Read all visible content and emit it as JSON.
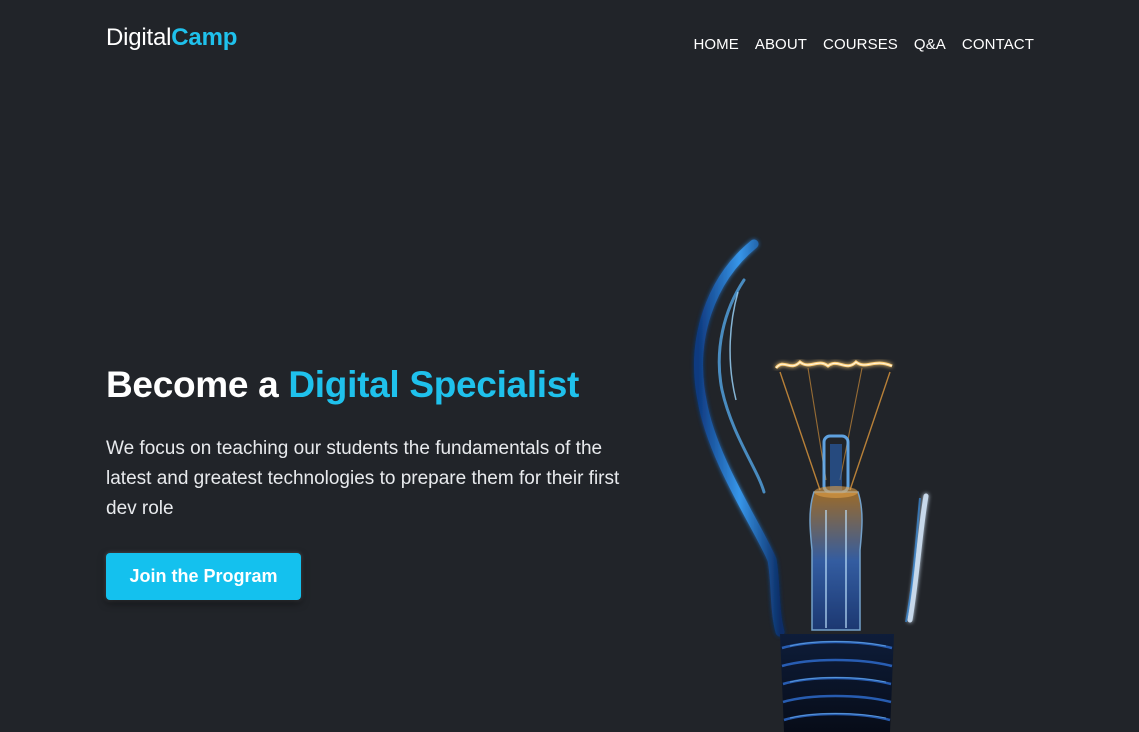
{
  "brand": {
    "prefix": "Digital",
    "accent": "Camp"
  },
  "nav": {
    "items": [
      {
        "label": "HOME"
      },
      {
        "label": "ABOUT"
      },
      {
        "label": "COURSES"
      },
      {
        "label": "Q&A"
      },
      {
        "label": "CONTACT"
      }
    ]
  },
  "hero": {
    "title_prefix": "Become a ",
    "title_accent": "Digital Specialist",
    "description": "We focus on teaching our students the fundamentals of the latest and greatest technologies to prepare them for their first dev role",
    "button_label": "Join the Program",
    "image_icon": "light-bulb-illustration"
  },
  "colors": {
    "background": "#212429",
    "accent": "#1fc1ec",
    "button": "#14c1ee",
    "text": "#ffffff"
  }
}
